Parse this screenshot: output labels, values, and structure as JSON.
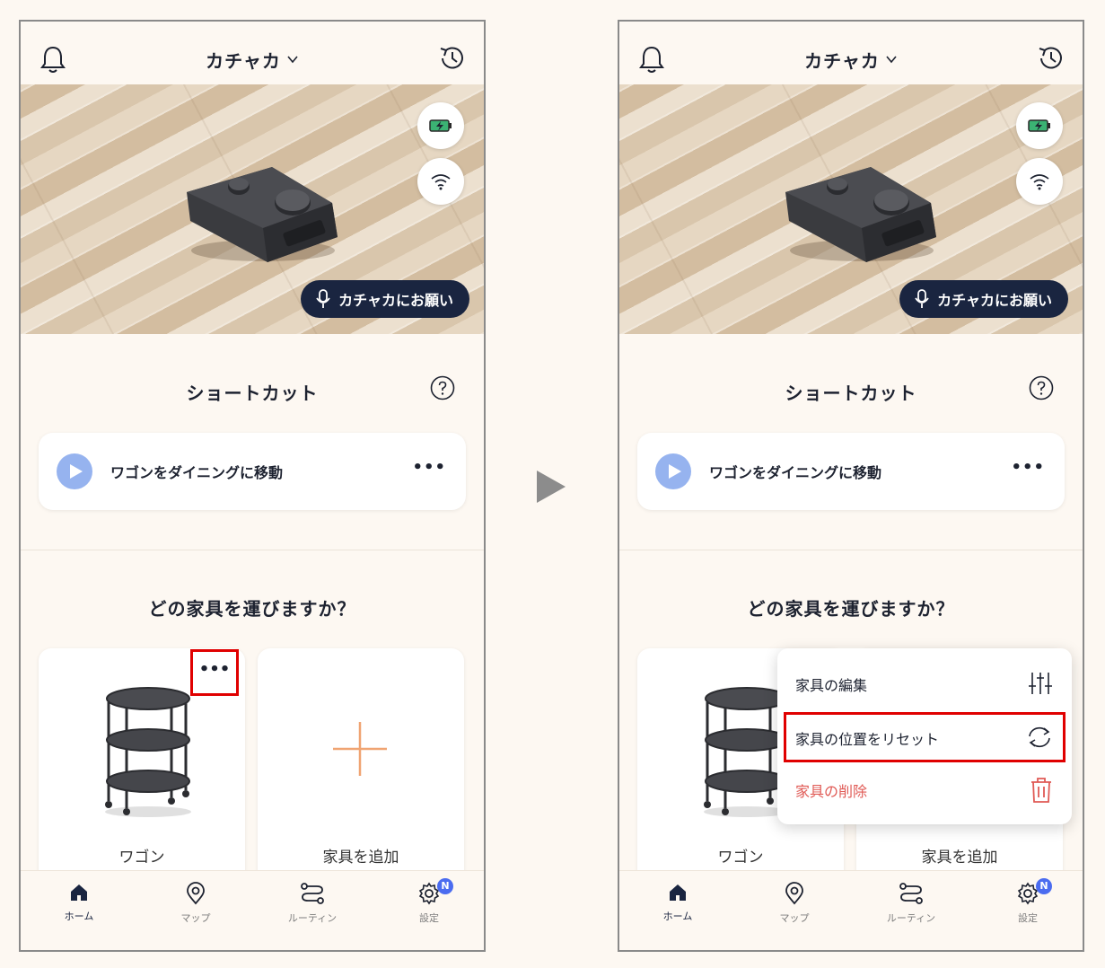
{
  "app": {
    "device_name": "カチャカ"
  },
  "hero": {
    "voice_button": "カチャカにお願い"
  },
  "shortcuts": {
    "title": "ショートカット",
    "items": [
      {
        "label": "ワゴンをダイニングに移動",
        "more": "•••"
      }
    ]
  },
  "furniture": {
    "title": "どの家具を運びますか？",
    "items": [
      {
        "label": "ワゴン"
      },
      {
        "label": "家具を追加"
      }
    ],
    "more": "•••"
  },
  "menu": {
    "items": [
      {
        "label": "家具の編集",
        "icon": "sliders-icon"
      },
      {
        "label": "家具の位置をリセット",
        "icon": "refresh-icon"
      },
      {
        "label": "家具の削除",
        "icon": "trash-icon",
        "color": "#e05a55"
      }
    ]
  },
  "tabbar": {
    "items": [
      {
        "label": "ホーム",
        "icon": "home-icon"
      },
      {
        "label": "マップ",
        "icon": "map-pin-icon"
      },
      {
        "label": "ルーティン",
        "icon": "routine-icon"
      },
      {
        "label": "設定",
        "icon": "gear-icon",
        "badge": "N"
      }
    ]
  },
  "colors": {
    "accent": "#1a2540",
    "highlight": "#e00000",
    "play": "#96b3ef",
    "plus": "#f0a472",
    "badge": "#4b6cf0"
  }
}
